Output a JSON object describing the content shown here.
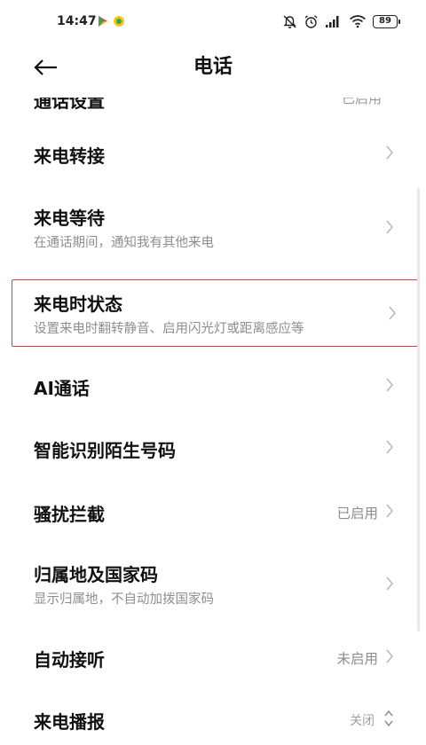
{
  "status_bar": {
    "time": "14:47",
    "battery": "89",
    "icons": [
      "play-store-icon",
      "app-notification-icon",
      "alarm-off-icon",
      "alarm-clock-icon",
      "signal-icon",
      "wifi-icon",
      "battery-icon"
    ]
  },
  "header": {
    "title": "电话",
    "back_icon": "arrow-left-icon"
  },
  "clipped_item": {
    "title": "通话设置",
    "value": "已启用"
  },
  "items": [
    {
      "title": "来电转接",
      "subtitle": "",
      "value": ""
    },
    {
      "title": "来电等待",
      "subtitle": "在通话期间，通知我有其他来电",
      "value": ""
    },
    {
      "title": "来电时状态",
      "subtitle": "设置来电时翻转静音、启用闪光灯或距离感应等",
      "value": ""
    },
    {
      "title": "AI通话",
      "subtitle": "",
      "value": ""
    },
    {
      "title": "智能识别陌生号码",
      "subtitle": "",
      "value": ""
    },
    {
      "title": "骚扰拦截",
      "subtitle": "",
      "value": "已启用"
    },
    {
      "title": "归属地及国家码",
      "subtitle": "显示归属地，不自动加拨国家码",
      "value": ""
    },
    {
      "title": "自动接听",
      "subtitle": "",
      "value": "未启用"
    },
    {
      "title": "来电播报",
      "subtitle": "",
      "value": "关闭"
    }
  ],
  "colors": {
    "highlight_border": "#e0393b",
    "subtitle": "#8e8e8e",
    "title": "#111111"
  }
}
